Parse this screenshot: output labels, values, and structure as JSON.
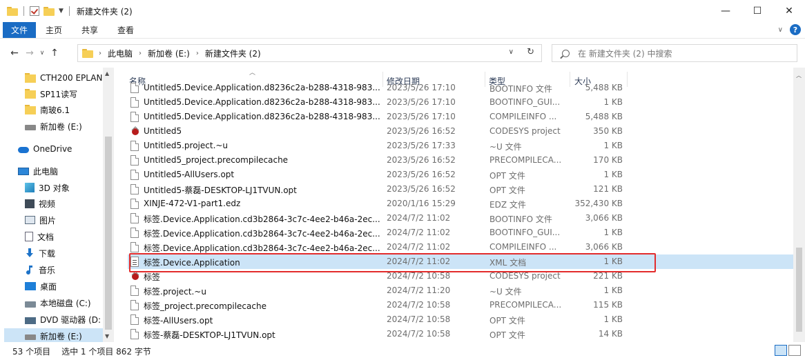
{
  "window": {
    "title": "新建文件夹 (2)",
    "controls": {
      "minimize": "—",
      "maximize": "☐",
      "close": "✕"
    }
  },
  "ribbon": {
    "tabs": [
      "文件",
      "主页",
      "共享",
      "查看"
    ]
  },
  "address": {
    "crumbs": [
      "此电脑",
      "新加卷 (E:)",
      "新建文件夹 (2)"
    ],
    "search_placeholder": "在 新建文件夹 (2) 中搜索"
  },
  "nav": {
    "items": [
      {
        "label": "CTH200 EPLAN",
        "icon": "folder-icon"
      },
      {
        "label": "SP11读写",
        "icon": "folder-icon"
      },
      {
        "label": "南玻6.1",
        "icon": "folder-icon"
      },
      {
        "label": "新加卷 (E:)",
        "icon": "drive-icon"
      },
      {
        "label": "OneDrive",
        "icon": "onedrive-icon"
      },
      {
        "label": "此电脑",
        "icon": "this-pc-icon"
      },
      {
        "label": "3D 对象",
        "icon": "3d-objects-icon"
      },
      {
        "label": "视频",
        "icon": "video-icon"
      },
      {
        "label": "图片",
        "icon": "pictures-icon"
      },
      {
        "label": "文档",
        "icon": "documents-icon"
      },
      {
        "label": "下载",
        "icon": "download-icon"
      },
      {
        "label": "音乐",
        "icon": "music-icon"
      },
      {
        "label": "桌面",
        "icon": "desktop-icon"
      },
      {
        "label": "本地磁盘 (C:)",
        "icon": "local-disk-icon"
      },
      {
        "label": "DVD 驱动器 (D:",
        "icon": "dvd-drive-icon"
      },
      {
        "label": "新加卷 (E:)",
        "icon": "drive-icon"
      }
    ]
  },
  "columns": {
    "name": "名称",
    "date": "修改日期",
    "type": "类型",
    "size": "大小"
  },
  "files": [
    {
      "name": "Untitled5.Device.Application.d8236c2a-b288-4318-983...",
      "date": "2023/5/26 17:10",
      "type": "BOOTINFO 文件",
      "size": "5,488 KB",
      "icon": "file-icon"
    },
    {
      "name": "Untitled5.Device.Application.d8236c2a-b288-4318-983...",
      "date": "2023/5/26 17:10",
      "type": "BOOTINFO_GUI...",
      "size": "1 KB",
      "icon": "file-icon"
    },
    {
      "name": "Untitled5.Device.Application.d8236c2a-b288-4318-983...",
      "date": "2023/5/26 17:10",
      "type": "COMPILEINFO ...",
      "size": "5,488 KB",
      "icon": "file-icon"
    },
    {
      "name": "Untitled5",
      "date": "2023/5/26 16:52",
      "type": "CODESYS project",
      "size": "350 KB",
      "icon": "codesys-icon"
    },
    {
      "name": "Untitled5.project.~u",
      "date": "2023/5/26 17:33",
      "type": "~U 文件",
      "size": "1 KB",
      "icon": "file-icon"
    },
    {
      "name": "Untitled5_project.precompilecache",
      "date": "2023/5/26 16:52",
      "type": "PRECOMPILECA...",
      "size": "170 KB",
      "icon": "file-icon"
    },
    {
      "name": "Untitled5-AllUsers.opt",
      "date": "2023/5/26 16:52",
      "type": "OPT 文件",
      "size": "1 KB",
      "icon": "file-icon"
    },
    {
      "name": "Untitled5-蔡磊-DESKTOP-LJ1TVUN.opt",
      "date": "2023/5/26 16:52",
      "type": "OPT 文件",
      "size": "121 KB",
      "icon": "file-icon"
    },
    {
      "name": "XINJE-472-V1-part1.edz",
      "date": "2020/1/16 15:29",
      "type": "EDZ 文件",
      "size": "352,430 KB",
      "icon": "file-icon"
    },
    {
      "name": "标签.Device.Application.cd3b2864-3c7c-4ee2-b46a-2ec...",
      "date": "2024/7/2 11:02",
      "type": "BOOTINFO 文件",
      "size": "3,066 KB",
      "icon": "file-icon"
    },
    {
      "name": "标签.Device.Application.cd3b2864-3c7c-4ee2-b46a-2ec...",
      "date": "2024/7/2 11:02",
      "type": "BOOTINFO_GUI...",
      "size": "1 KB",
      "icon": "file-icon"
    },
    {
      "name": "标签.Device.Application.cd3b2864-3c7c-4ee2-b46a-2ec...",
      "date": "2024/7/2 11:02",
      "type": "COMPILEINFO ...",
      "size": "3,066 KB",
      "icon": "file-icon"
    },
    {
      "name": "标签.Device.Application",
      "date": "2024/7/2 11:02",
      "type": "XML 文档",
      "size": "1 KB",
      "icon": "xml-document-icon",
      "selected": true
    },
    {
      "name": "标签",
      "date": "2024/7/2 10:58",
      "type": "CODESYS project",
      "size": "221 KB",
      "icon": "codesys-icon"
    },
    {
      "name": "标签.project.~u",
      "date": "2024/7/2 11:20",
      "type": "~U 文件",
      "size": "1 KB",
      "icon": "file-icon"
    },
    {
      "name": "标签_project.precompilecache",
      "date": "2024/7/2 10:58",
      "type": "PRECOMPILECA...",
      "size": "115 KB",
      "icon": "file-icon"
    },
    {
      "name": "标签-AllUsers.opt",
      "date": "2024/7/2 10:58",
      "type": "OPT 文件",
      "size": "1 KB",
      "icon": "file-icon"
    },
    {
      "name": "标签-蔡磊-DESKTOP-LJ1TVUN.opt",
      "date": "2024/7/2 10:58",
      "type": "OPT 文件",
      "size": "14 KB",
      "icon": "file-icon"
    }
  ],
  "status": {
    "count": "53 个项目",
    "selection": "选中 1 个项目  862 字节"
  },
  "colors": {
    "accent": "#1a6cc4",
    "selection": "#cce4f7",
    "highlight_box": "#e32b2b"
  }
}
